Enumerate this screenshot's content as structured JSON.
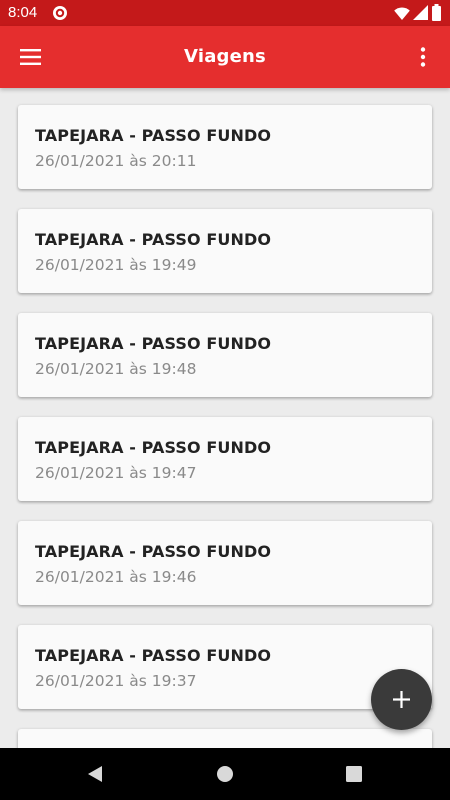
{
  "status_bar": {
    "time": "8:04",
    "icons": [
      "app-notification-icon",
      "wifi-icon",
      "cell-signal-icon",
      "battery-icon"
    ]
  },
  "app_bar": {
    "title": "Viagens",
    "menu_icon": "hamburger-menu-icon",
    "overflow_icon": "more-vertical-icon"
  },
  "trips": [
    {
      "route": "TAPEJARA - PASSO FUNDO",
      "date": "26/01/2021 às 20:11"
    },
    {
      "route": "TAPEJARA - PASSO FUNDO",
      "date": "26/01/2021 às 19:49"
    },
    {
      "route": "TAPEJARA - PASSO FUNDO",
      "date": "26/01/2021 às 19:48"
    },
    {
      "route": "TAPEJARA - PASSO FUNDO",
      "date": "26/01/2021 às 19:47"
    },
    {
      "route": "TAPEJARA - PASSO FUNDO",
      "date": "26/01/2021 às 19:46"
    },
    {
      "route": "TAPEJARA - PASSO FUNDO",
      "date": "26/01/2021 às 19:37"
    },
    {
      "route": "",
      "date": ""
    }
  ],
  "fab": {
    "icon": "plus-icon"
  },
  "nav_bar": {
    "icons": [
      "back-icon",
      "home-icon",
      "recents-icon"
    ]
  },
  "colors": {
    "status_bar": "#c4191a",
    "app_bar": "#e52e2e",
    "background": "#ececec",
    "card": "#fafafa",
    "title_text": "#222222",
    "date_text": "#8a8a8a",
    "fab": "#3a3a3a"
  }
}
